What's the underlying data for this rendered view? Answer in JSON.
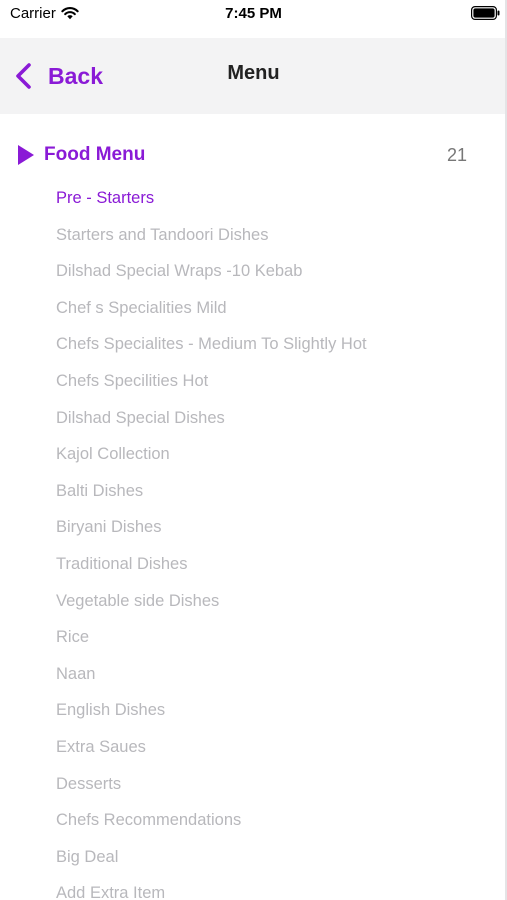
{
  "status_bar": {
    "carrier": "Carrier",
    "time": "7:45 PM",
    "wifi_icon": "wifi-icon",
    "battery_icon": "battery-icon"
  },
  "nav": {
    "back_label": "Back",
    "title": "Menu"
  },
  "section": {
    "title": "Food Menu",
    "count": "21"
  },
  "items": [
    {
      "label": "Pre - Starters",
      "active": true
    },
    {
      "label": "Starters and Tandoori Dishes"
    },
    {
      "label": "Dilshad Special Wraps -10 Kebab"
    },
    {
      "label": "Chef s Specialities Mild"
    },
    {
      "label": "Chefs Specialites - Medium To Slightly Hot"
    },
    {
      "label": "Chefs Specilities Hot"
    },
    {
      "label": "Dilshad Special Dishes"
    },
    {
      "label": "Kajol Collection"
    },
    {
      "label": "Balti Dishes"
    },
    {
      "label": "Biryani Dishes"
    },
    {
      "label": "Traditional Dishes"
    },
    {
      "label": "Vegetable side Dishes"
    },
    {
      "label": "Rice"
    },
    {
      "label": "Naan"
    },
    {
      "label": "English Dishes"
    },
    {
      "label": "Extra Saues"
    },
    {
      "label": "Desserts"
    },
    {
      "label": "Chefs Recommendations"
    },
    {
      "label": "Big Deal"
    },
    {
      "label": "Add Extra Item"
    }
  ],
  "colors": {
    "accent": "#8a1ad6",
    "inactive_item": "#b8b8bc",
    "nav_background": "#f3f3f4"
  }
}
